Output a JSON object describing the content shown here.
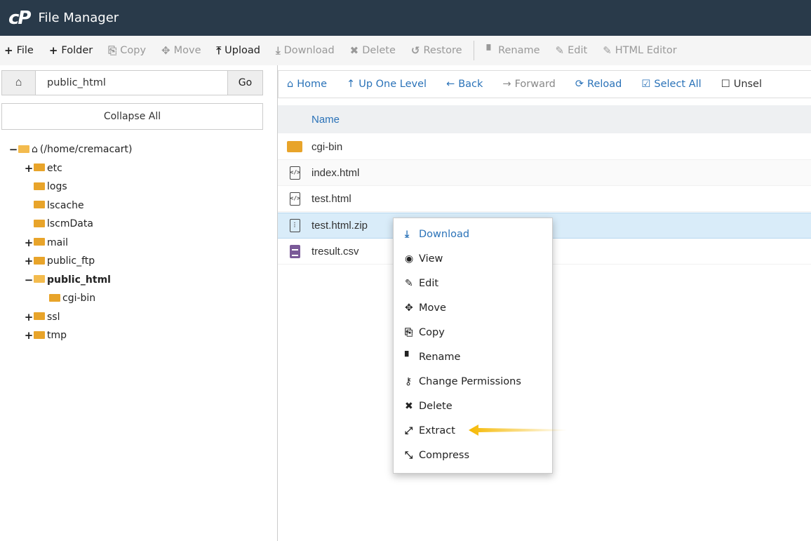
{
  "header": {
    "logo": "cP",
    "title": "File Manager"
  },
  "toolbar": {
    "items": [
      {
        "icon": "+",
        "label": "File"
      },
      {
        "icon": "+",
        "label": "Folder"
      },
      {
        "icon": "⎘",
        "label": "Copy"
      },
      {
        "icon": "✥",
        "label": "Move"
      },
      {
        "icon": "⤒",
        "label": "Upload"
      },
      {
        "icon": "⤓",
        "label": "Download"
      },
      {
        "icon": "✖",
        "label": "Delete"
      },
      {
        "icon": "↺",
        "label": "Restore"
      },
      {
        "icon": "▘",
        "label": "Rename"
      },
      {
        "icon": "✎",
        "label": "Edit"
      },
      {
        "icon": "✎",
        "label": "HTML Editor"
      }
    ]
  },
  "left": {
    "path_value": "public_html",
    "go_label": "Go",
    "collapse_label": "Collapse All",
    "tree": [
      {
        "toggle": "−",
        "label": "(/home/cremacart)"
      },
      {
        "toggle": "+",
        "label": "etc"
      },
      {
        "toggle": "",
        "label": "logs"
      },
      {
        "toggle": "",
        "label": "lscache"
      },
      {
        "toggle": "",
        "label": "lscmData"
      },
      {
        "toggle": "+",
        "label": "mail"
      },
      {
        "toggle": "+",
        "label": "public_ftp"
      },
      {
        "toggle": "−",
        "label": "public_html"
      },
      {
        "toggle": "",
        "label": "cgi-bin"
      },
      {
        "toggle": "+",
        "label": "ssl"
      },
      {
        "toggle": "+",
        "label": "tmp"
      }
    ]
  },
  "nav": {
    "items": [
      {
        "icon": "⌂",
        "label": "Home"
      },
      {
        "icon": "↑",
        "label": "Up One Level"
      },
      {
        "icon": "←",
        "label": "Back"
      },
      {
        "icon": "→",
        "label": "Forward"
      },
      {
        "icon": "⟳",
        "label": "Reload"
      },
      {
        "icon": "☑",
        "label": "Select All"
      },
      {
        "icon": "☐",
        "label": "Unsel"
      }
    ]
  },
  "list": {
    "header_name": "Name",
    "files": [
      {
        "name": "cgi-bin",
        "icon": "folder-icon"
      },
      {
        "name": "index.html",
        "icon": "html-file-icon"
      },
      {
        "name": "test.html",
        "icon": "html-file-icon"
      },
      {
        "name": "test.html.zip",
        "icon": "zip-file-icon"
      },
      {
        "name": "tresult.csv",
        "icon": "csv-file-icon"
      }
    ]
  },
  "context_menu": {
    "items": [
      {
        "icon": "⤓",
        "label": "Download"
      },
      {
        "icon": "◉",
        "label": "View"
      },
      {
        "icon": "✎",
        "label": "Edit"
      },
      {
        "icon": "✥",
        "label": "Move"
      },
      {
        "icon": "⎘",
        "label": "Copy"
      },
      {
        "icon": "▘",
        "label": "Rename"
      },
      {
        "icon": "⚷",
        "label": "Change Permissions"
      },
      {
        "icon": "✖",
        "label": "Delete"
      },
      {
        "icon": "⤢",
        "label": "Extract"
      },
      {
        "icon": "⤡",
        "label": "Compress"
      }
    ]
  },
  "colors": {
    "header_bg": "#293a4a",
    "accent": "#2a72b8",
    "folder": "#e8a42a",
    "selected_row": "#d9ecf9",
    "arrow": "#f5b800"
  }
}
